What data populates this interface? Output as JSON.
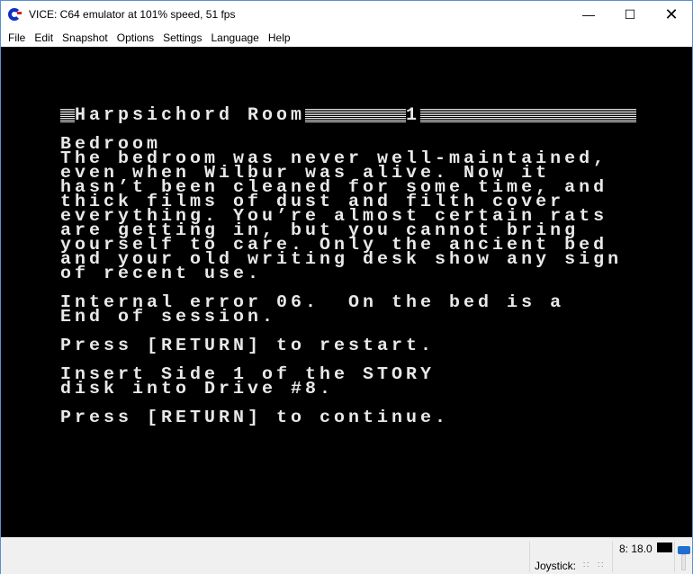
{
  "window": {
    "title": "VICE: C64 emulator at 101% speed, 51 fps",
    "controls": [
      "minimize",
      "maximize",
      "close"
    ]
  },
  "menu": [
    "File",
    "Edit",
    "Snapshot",
    "Options",
    "Settings",
    "Language",
    "Help"
  ],
  "c64": {
    "header": {
      "location": "Harpsichord Room",
      "score": "1"
    },
    "lines": [
      "",
      "Bedroom",
      "The bedroom was never well-maintained,",
      "even when Wilbur was alive. Now it",
      "hasn’t been cleaned for some time, and",
      "thick films of dust and filth cover",
      "everything. You’re almost certain rats",
      "are getting in, but you cannot bring",
      "yourself to care. Only the ancient bed",
      "and your old writing desk show any sign",
      "of recent use.",
      "",
      "Internal error 06.  On the bed is a",
      "End of session.",
      "",
      "Press [RETURN] to restart.",
      "",
      "Insert Side 1 of the STORY",
      "disk into Drive #8.",
      "",
      "Press [RETURN] to continue."
    ]
  },
  "status": {
    "joystick_label": "Joystick:",
    "drive": "8: 18.0",
    "drive_led_color": "#000000"
  }
}
